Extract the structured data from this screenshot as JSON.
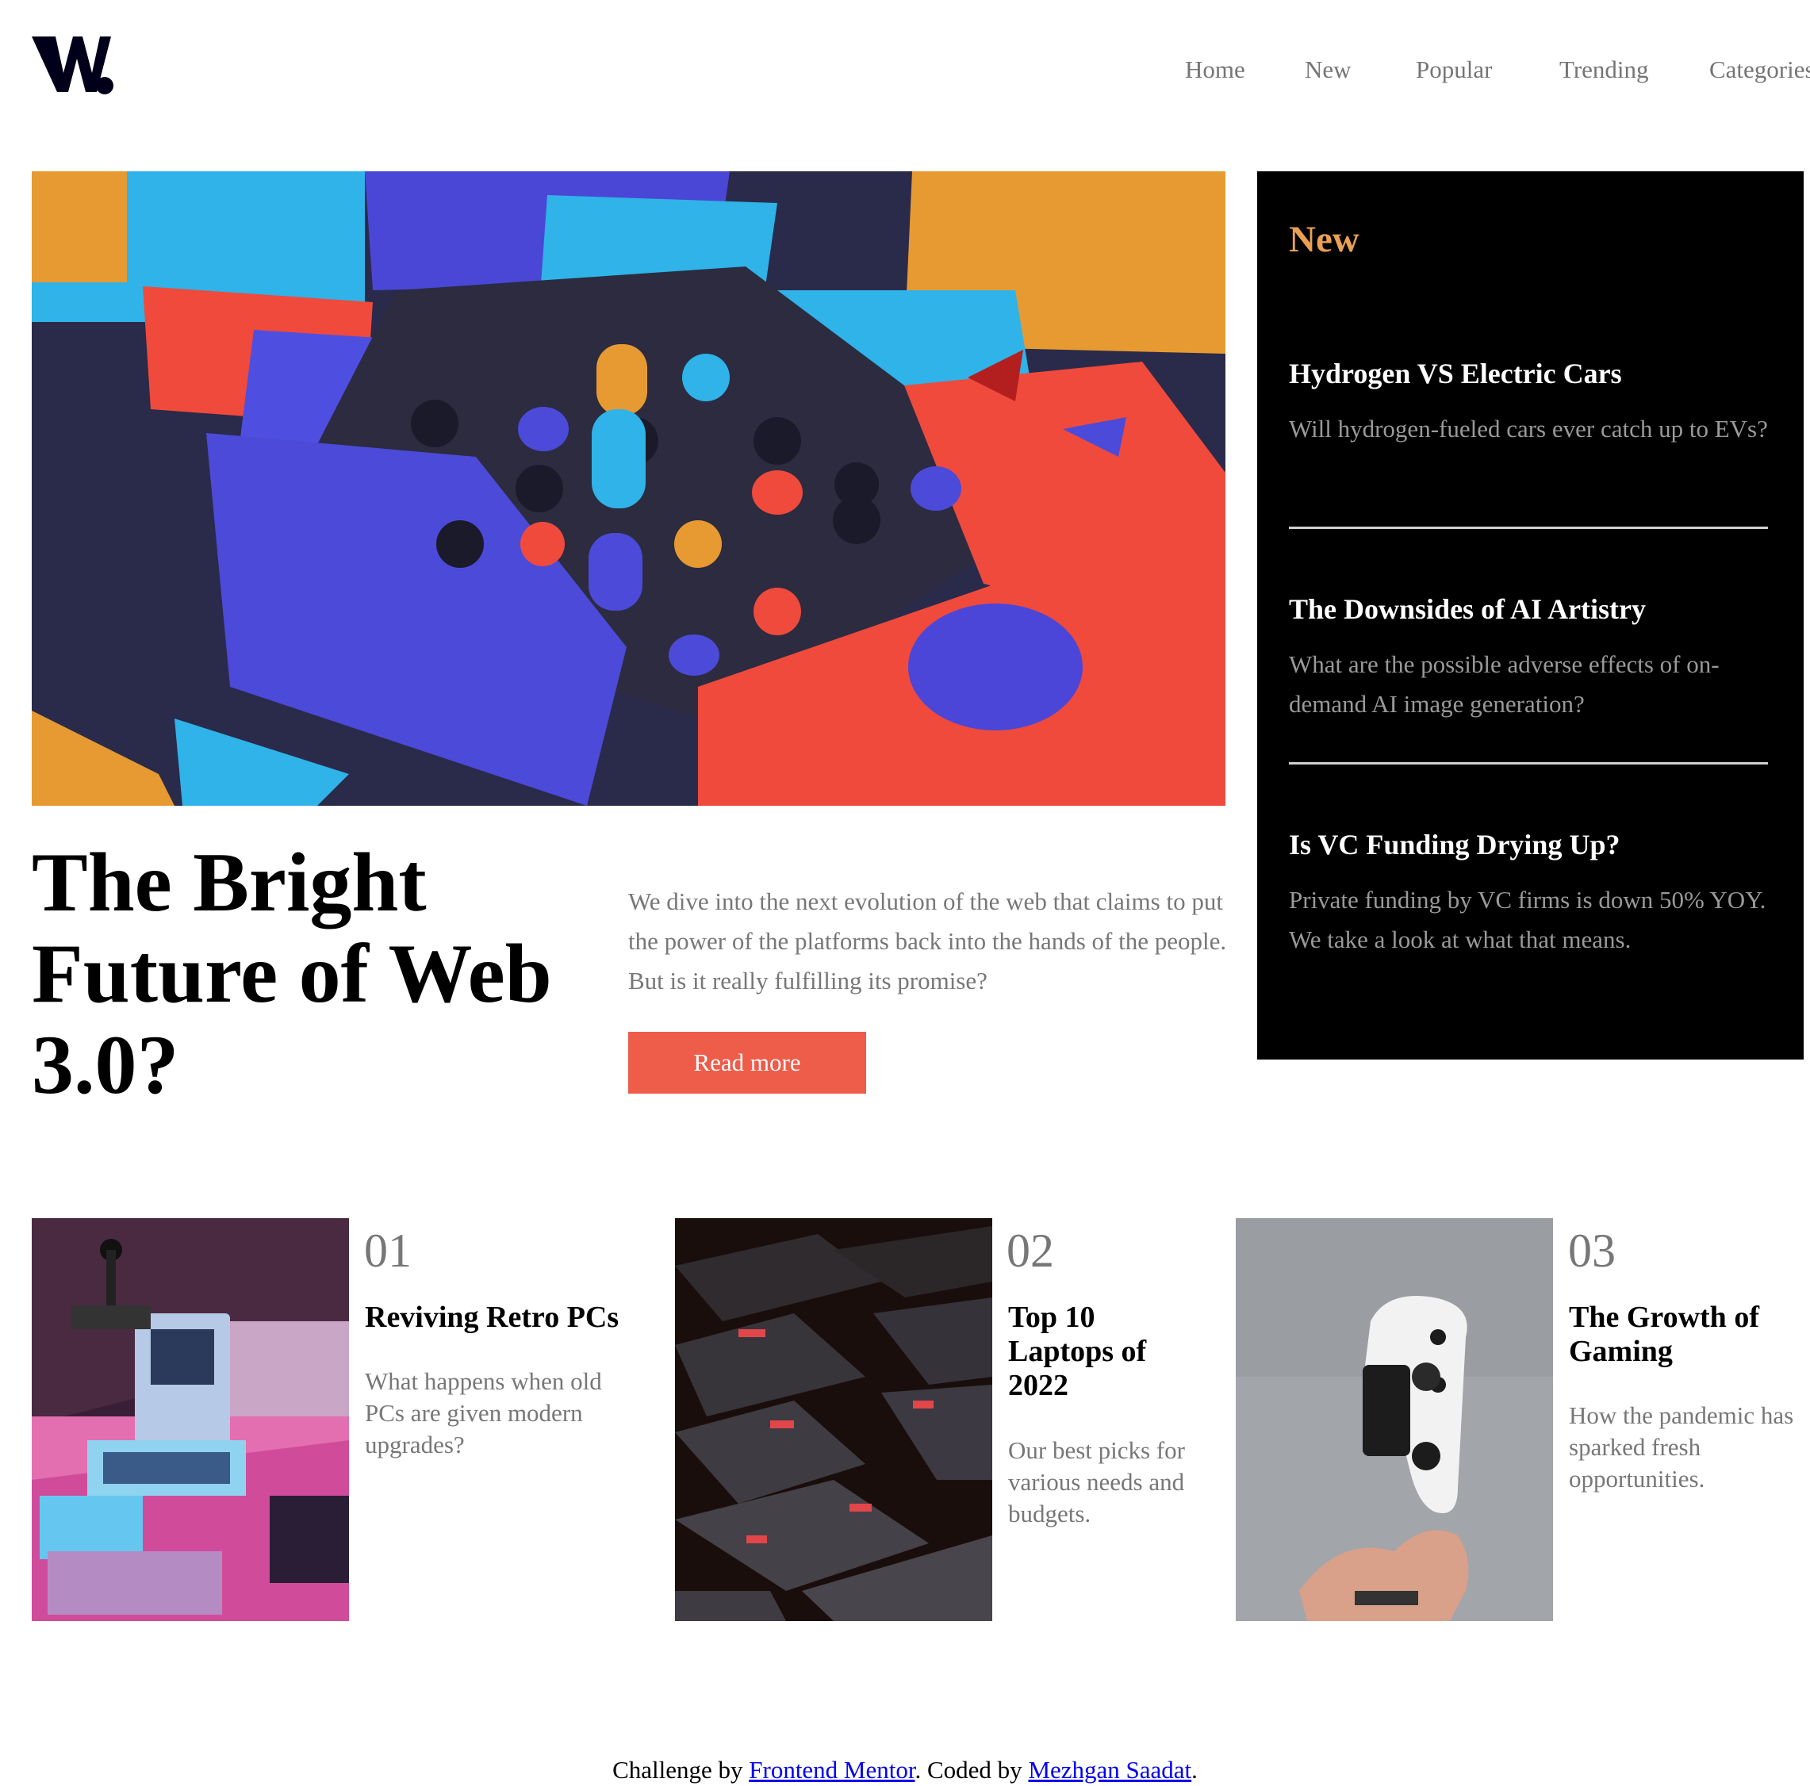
{
  "brand": {
    "logo_text": "W.",
    "accent": "#EE5C4A",
    "gold": "#E9A054"
  },
  "nav": {
    "items": [
      "Home",
      "New",
      "Popular",
      "Trending",
      "Categories"
    ]
  },
  "hero": {
    "title": "The Bright Future of Web 3.0?",
    "description": "We dive into the next evolution of the web that claims to put the power of the platforms back into the hands of the people. But is it really fulfilling its promise?",
    "button_label": "Read more"
  },
  "sidebar": {
    "title": "New",
    "items": [
      {
        "title": "Hydrogen VS Electric Cars",
        "description": "Will hydrogen-fueled cars ever catch up to EVs?"
      },
      {
        "title": "The Downsides of AI Artistry",
        "description": "What are the possible adverse effects of on-demand AI image generation?"
      },
      {
        "title": "Is VC Funding Drying Up?",
        "description": "Private funding by VC firms is down 50% YOY. We take a look at what that means."
      }
    ]
  },
  "cards": [
    {
      "number": "01",
      "title": "Reviving Retro PCs",
      "description": "What happens when old PCs are given modern upgrades?"
    },
    {
      "number": "02",
      "title": "Top 10 Laptops of 2022",
      "description": "Our best picks for various needs and budgets."
    },
    {
      "number": "03",
      "title": "The Growth of Gaming",
      "description": "How the pandemic has sparked fresh opportunities."
    }
  ],
  "footer": {
    "prefix": "Challenge by ",
    "link1": "Frontend Mentor",
    "middle": ". Coded by ",
    "link2": "Mezhgan Saadat",
    "suffix": "."
  }
}
